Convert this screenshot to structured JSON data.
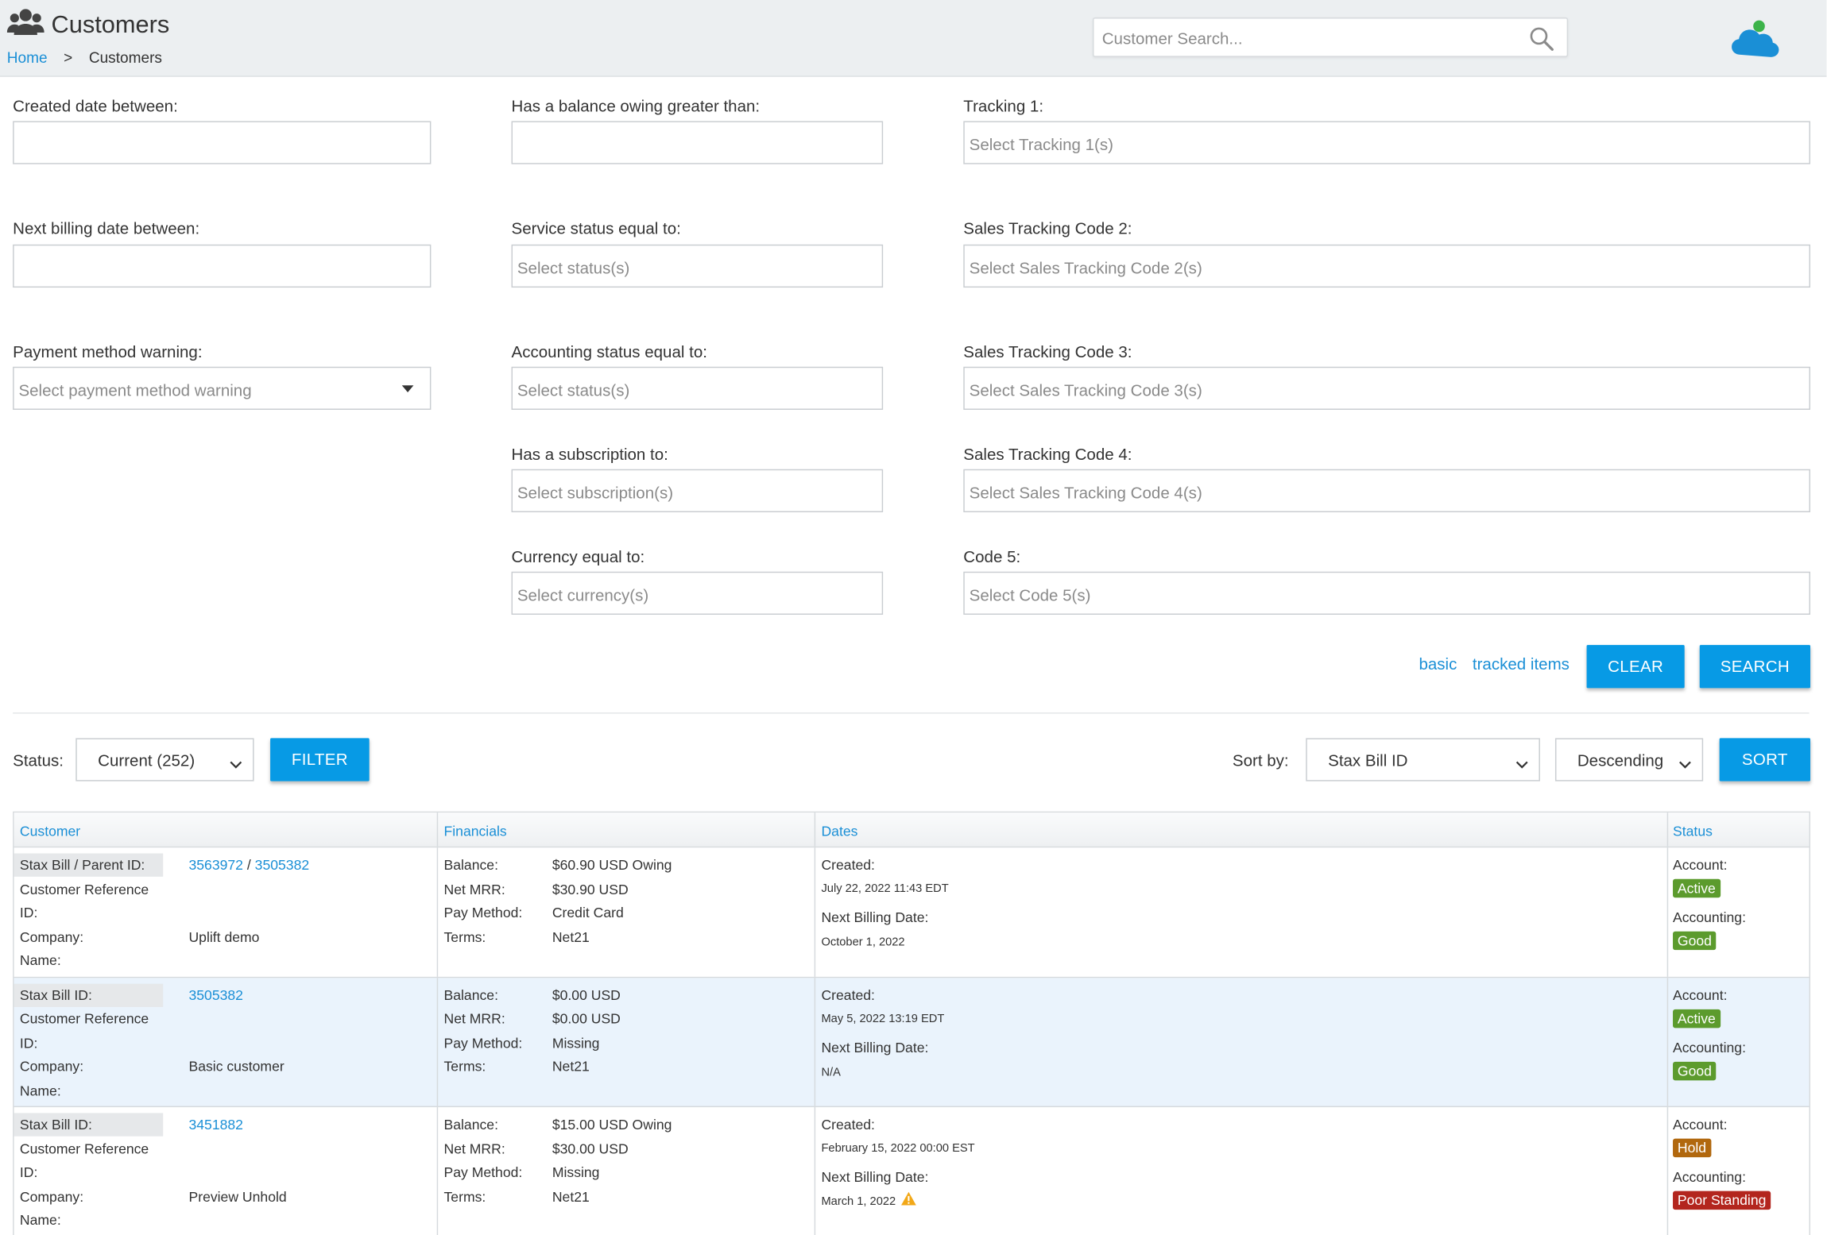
{
  "header": {
    "title": "Customers",
    "breadcrumb": {
      "home": "Home",
      "separator": ">",
      "current": "Customers"
    },
    "search_placeholder": "Customer Search..."
  },
  "filters": {
    "created_label": "Created date between:",
    "next_billing_label": "Next billing date between:",
    "payment_warning_label": "Payment method warning:",
    "payment_warning_placeholder": "Select payment method warning",
    "balance_label": "Has a balance owing greater than:",
    "service_status_label": "Service status equal to:",
    "service_status_placeholder": "Select status(s)",
    "accounting_status_label": "Accounting status equal to:",
    "accounting_status_placeholder": "Select status(s)",
    "subscription_label": "Has a subscription to:",
    "subscription_placeholder": "Select subscription(s)",
    "currency_label": "Currency equal to:",
    "currency_placeholder": "Select currency(s)",
    "tracking1_label": "Tracking 1:",
    "tracking1_placeholder": "Select Tracking 1(s)",
    "stc2_label": "Sales Tracking Code 2:",
    "stc2_placeholder": "Select Sales Tracking Code 2(s)",
    "stc3_label": "Sales Tracking Code 3:",
    "stc3_placeholder": "Select Sales Tracking Code 3(s)",
    "stc4_label": "Sales Tracking Code 4:",
    "stc4_placeholder": "Select Sales Tracking Code 4(s)",
    "code5_label": "Code 5:",
    "code5_placeholder": "Select Code 5(s)",
    "link_basic": "basic",
    "link_tracked": "tracked items",
    "clear": "CLEAR",
    "search": "SEARCH"
  },
  "toolbar": {
    "status_label": "Status:",
    "status_value": "Current (252)",
    "filter": "FILTER",
    "sort_label": "Sort by:",
    "sort_field": "Stax Bill ID",
    "sort_order": "Descending",
    "sort": "SORT"
  },
  "table": {
    "headers": [
      "Customer",
      "Financials",
      "Dates",
      "Status"
    ],
    "labels": {
      "ref1": "Customer Reference",
      "ref2": "ID:",
      "company1": "Company:",
      "company2": "Name:",
      "balance": "Balance:",
      "mrr": "Net MRR:",
      "pay": "Pay Method:",
      "terms": "Terms:",
      "created": "Created:",
      "next": "Next Billing Date:",
      "account": "Account:",
      "accounting": "Accounting:"
    },
    "rows": [
      {
        "id_label": "Stax Bill / Parent ID:",
        "id": "3563972",
        "slash": "/",
        "parent_id": "3505382",
        "company": "Uplift demo",
        "balance": "$60.90 USD Owing",
        "mrr": "$30.90 USD",
        "pay": "Credit Card",
        "terms": "Net21",
        "created": "July 22, 2022 11:43 EDT",
        "next": "October 1, 2022",
        "account": "Active",
        "accounting": "Good"
      },
      {
        "id_label": "Stax Bill ID:",
        "id": "3505382",
        "company": "Basic customer",
        "balance": "$0.00 USD",
        "mrr": "$0.00 USD",
        "pay": "Missing",
        "terms": "Net21",
        "created": "May 5, 2022 13:19 EDT",
        "next": "N/A",
        "account": "Active",
        "accounting": "Good"
      },
      {
        "id_label": "Stax Bill ID:",
        "id": "3451882",
        "company": "Preview Unhold",
        "balance": "$15.00 USD Owing",
        "mrr": "$30.00 USD",
        "pay": "Missing",
        "terms": "Net21",
        "created": "February 15, 2022 00:00 EST",
        "next": "March 1, 2022",
        "account": "Hold",
        "accounting": "Poor Standing"
      }
    ]
  },
  "colors": {
    "accent": "#079ae5",
    "link": "#1a8fd6",
    "active": "#5c9b2d",
    "hold": "#b1680e",
    "poor": "#b3261e"
  }
}
